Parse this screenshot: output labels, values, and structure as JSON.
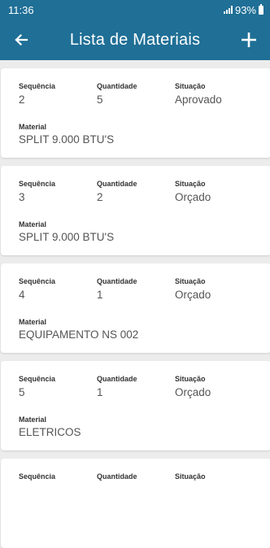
{
  "status": {
    "time": "11:36",
    "battery": "93%"
  },
  "header": {
    "title": "Lista de Materiais",
    "back_icon": "arrow-left-icon",
    "add_icon": "plus-icon"
  },
  "labels": {
    "sequencia": "Sequência",
    "quantidade": "Quantidade",
    "situacao": "Situação",
    "material": "Material"
  },
  "items": [
    {
      "sequencia": "2",
      "quantidade": "5",
      "situacao": "Aprovado",
      "material": "SPLIT 9.000 BTU'S"
    },
    {
      "sequencia": "3",
      "quantidade": "2",
      "situacao": "Orçado",
      "material": "SPLIT 9.000 BTU'S"
    },
    {
      "sequencia": "4",
      "quantidade": "1",
      "situacao": "Orçado",
      "material": "EQUIPAMENTO NS 002"
    },
    {
      "sequencia": "5",
      "quantidade": "1",
      "situacao": "Orçado",
      "material": "ELETRICOS"
    },
    {
      "sequencia": "",
      "quantidade": "",
      "situacao": "",
      "material": ""
    }
  ],
  "colors": {
    "primary": "#1f6f96",
    "background": "#ececec",
    "card": "#ffffff"
  }
}
